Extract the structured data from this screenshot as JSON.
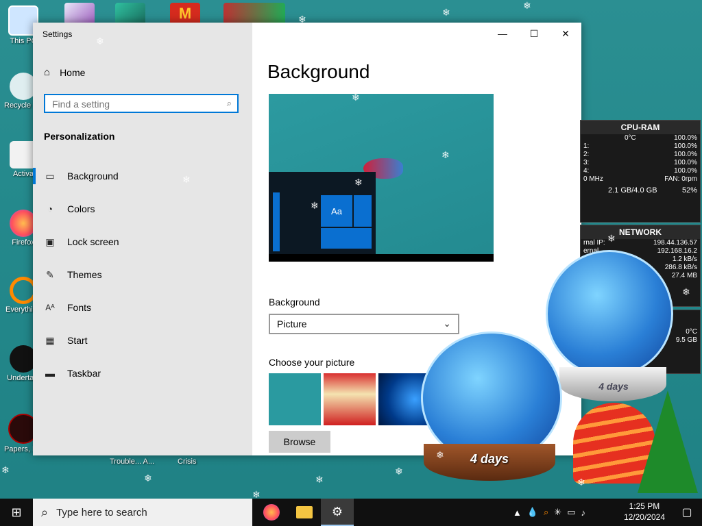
{
  "desktop": {
    "icons": [
      {
        "label": "This PC",
        "icon": "this-pc-icon"
      },
      {
        "label": "Recycle Bin",
        "icon": "recycle-bin-icon"
      },
      {
        "label": "Activa",
        "icon": "folder-icon"
      },
      {
        "label": "Firefox",
        "icon": "firefox-icon"
      },
      {
        "label": "Everything",
        "icon": "search-app-icon"
      },
      {
        "label": "Undertale",
        "icon": "undertale-icon"
      },
      {
        "label": "Papers, Please",
        "icon": "papers-please-icon"
      }
    ],
    "bottom_labels": [
      "Trouble... A...",
      "Crisis"
    ]
  },
  "window": {
    "title": "Settings",
    "controls": {
      "minimize": "—",
      "maximize": "☐",
      "close": "✕"
    },
    "sidebar": {
      "home": "Home",
      "search_placeholder": "Find a setting",
      "section": "Personalization",
      "items": [
        {
          "label": "Background",
          "icon": "picture-icon",
          "active": true
        },
        {
          "label": "Colors",
          "icon": "palette-icon"
        },
        {
          "label": "Lock screen",
          "icon": "lock-screen-icon"
        },
        {
          "label": "Themes",
          "icon": "brush-icon"
        },
        {
          "label": "Fonts",
          "icon": "font-icon"
        },
        {
          "label": "Start",
          "icon": "start-tiles-icon"
        },
        {
          "label": "Taskbar",
          "icon": "taskbar-icon"
        }
      ]
    },
    "main": {
      "heading": "Background",
      "preview_tile_label": "Aa",
      "background_label": "Background",
      "background_value": "Picture",
      "choose_label": "Choose your picture",
      "browse": "Browse"
    }
  },
  "gadgets": {
    "cpu": {
      "title": "CPU-RAM",
      "temp": "0°C",
      "total": "100.0%",
      "cores": [
        {
          "id": "1:",
          "val": "100.0%"
        },
        {
          "id": "2:",
          "val": "100.0%"
        },
        {
          "id": "3:",
          "val": "100.0%"
        },
        {
          "id": "4:",
          "val": "100.0%"
        }
      ],
      "freq": "0 MHz",
      "fan": "FAN: 0rpm",
      "ram": "2.1 GB/4.0 GB",
      "ram_pct": "52%"
    },
    "network": {
      "title": "NETWORK",
      "rows": [
        {
          "k": "rnal IP:",
          "v": "198.44.136.57"
        },
        {
          "k": "ernal",
          "v": "192.168.16.2"
        },
        {
          "k": "",
          "v": "1.2 kB/s"
        },
        {
          "k": "",
          "v": "286.8 kB/s"
        },
        {
          "k": "",
          "v": "27.4 MB"
        }
      ]
    },
    "other": {
      "temp": "0°C",
      "size": "9.5 GB"
    }
  },
  "globes": {
    "days_text": "4 days"
  },
  "taskbar": {
    "search_placeholder": "Type here to search",
    "time": "1:25 PM",
    "date": "12/20/2024"
  }
}
